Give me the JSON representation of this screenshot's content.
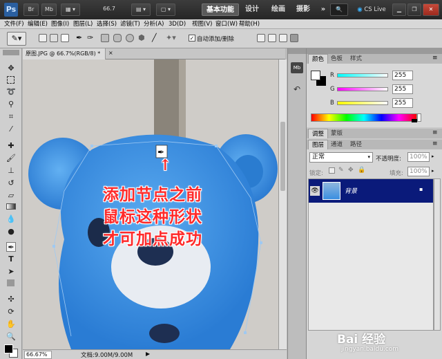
{
  "app": {
    "logo": "Ps",
    "zoom_value": "66.7",
    "launch_buttons": [
      "Br",
      "Mb"
    ]
  },
  "workspaces": [
    "基本功能",
    "设计",
    "绘画",
    "摄影"
  ],
  "cs_live": "CS Live",
  "window_controls": [
    "minimize",
    "restore",
    "close"
  ],
  "menu": [
    "文件(F)",
    "编辑(E)",
    "图像(I)",
    "图层(L)",
    "选择(S)",
    "滤镜(T)",
    "分析(A)",
    "3D(D)",
    "视图(V)",
    "窗口(W)",
    "帮助(H)"
  ],
  "options_bar": {
    "auto_add_delete": "自动添加/删除"
  },
  "document": {
    "tab_title": "原图.JPG @ 66.7%(RGB/8) *",
    "zoom": "66.67%",
    "doc_info": "文档:9.00M/9.00M"
  },
  "annotation": {
    "lines": [
      "添加节点之前",
      "鼠标这种形状",
      "才可加点成功"
    ],
    "arrow": "↑"
  },
  "color_panel": {
    "tabs": [
      "颜色",
      "色板",
      "样式"
    ],
    "channels": [
      {
        "label": "R",
        "value": "255"
      },
      {
        "label": "G",
        "value": "255"
      },
      {
        "label": "B",
        "value": "255"
      }
    ]
  },
  "adjust_tabs": [
    "调整",
    "蒙版"
  ],
  "layers_panel": {
    "tabs": [
      "图层",
      "通道",
      "路径"
    ],
    "blend_mode": "正常",
    "opacity_label": "不透明度:",
    "opacity": "100%",
    "lock_label": "锁定:",
    "fill_label": "填充:",
    "fill": "100%",
    "layers": [
      {
        "name": "背景"
      }
    ]
  },
  "watermark": {
    "brand": "Bai 经验",
    "url": "jingyan.baidu.com"
  },
  "colors": {
    "accent": "#0a1a7a",
    "caption": "#ff2a2a",
    "bear": "#3a8ee0"
  }
}
